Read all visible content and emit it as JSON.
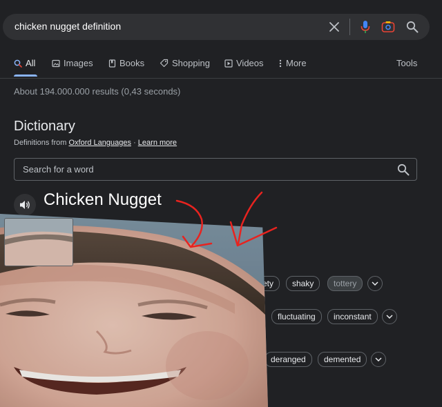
{
  "search": {
    "query": "chicken nugget definition"
  },
  "tabs": [
    {
      "label": "All",
      "icon": "search-icon",
      "active": true
    },
    {
      "label": "Images",
      "icon": "image-icon"
    },
    {
      "label": "Books",
      "icon": "book-icon"
    },
    {
      "label": "Shopping",
      "icon": "tag-icon"
    },
    {
      "label": "Videos",
      "icon": "play-icon"
    },
    {
      "label": "More",
      "icon": "more-vert-icon"
    }
  ],
  "tools_label": "Tools",
  "result_stats": "About 194.000.000 results (0,43 seconds)",
  "dictionary": {
    "title": "Dictionary",
    "source_prefix": "Definitions from",
    "source_link": "Oxford Languages",
    "separator": "·",
    "learn_more": "Learn more",
    "search_placeholder": "Search for a word",
    "headword": "Chicken Nugget"
  },
  "synonym_rows": [
    {
      "chips": [
        {
          "label": "ety",
          "dim": false
        },
        {
          "label": "shaky",
          "dim": false
        },
        {
          "label": "tottery",
          "dim": true
        }
      ]
    },
    {
      "chips": [
        {
          "label": "fluctuating",
          "dim": false
        },
        {
          "label": "inconstant",
          "dim": false
        }
      ]
    },
    {
      "chips": [
        {
          "label": "deranged",
          "dim": false
        },
        {
          "label": "demented",
          "dim": false
        }
      ]
    }
  ],
  "colors": {
    "background": "#202124",
    "searchbar": "#303134",
    "accent_blue": "#8ab4f8",
    "annotation_red": "#e8231f",
    "mic_blue": "#4285f4"
  }
}
